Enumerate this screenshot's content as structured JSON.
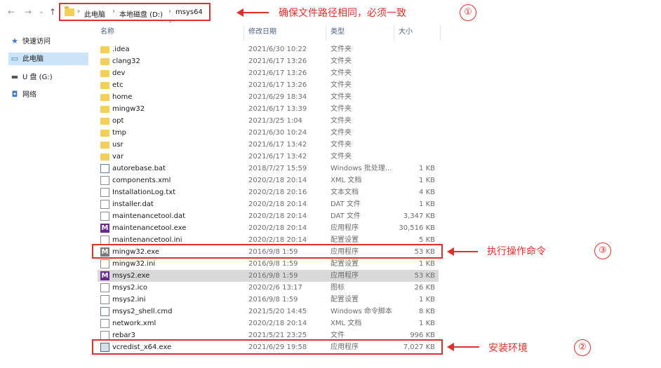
{
  "nav": {
    "back": "←",
    "forward": "→",
    "recent": "⌄",
    "up": "↑"
  },
  "breadcrumb": [
    "此电脑",
    "本地磁盘 (D:)",
    "msys64"
  ],
  "breadcrumb_sep": "›",
  "annotations": [
    {
      "text": "确保文件路径相同，必须一致",
      "number": "①"
    },
    {
      "text": "执行操作命令",
      "number": "③"
    },
    {
      "text": "安装环境",
      "number": "②"
    }
  ],
  "sidebar": [
    {
      "label": "快速访问",
      "icon": "star-icon",
      "selected": false
    },
    {
      "label": "此电脑",
      "icon": "computer-icon",
      "selected": true
    },
    {
      "label": "U 盘 (G:)",
      "icon": "usb-drive-icon",
      "selected": false
    },
    {
      "label": "网络",
      "icon": "network-icon",
      "selected": false
    }
  ],
  "columns": {
    "name": "名称",
    "date": "修改日期",
    "type": "类型",
    "size": "大小"
  },
  "files": [
    {
      "name": ".idea",
      "date": "2021/6/30 10:22",
      "type": "文件夹",
      "size": "",
      "icon": "folder"
    },
    {
      "name": "clang32",
      "date": "2021/6/17 13:26",
      "type": "文件夹",
      "size": "",
      "icon": "folder"
    },
    {
      "name": "dev",
      "date": "2021/6/17 13:26",
      "type": "文件夹",
      "size": "",
      "icon": "folder"
    },
    {
      "name": "etc",
      "date": "2021/6/17 13:26",
      "type": "文件夹",
      "size": "",
      "icon": "folder"
    },
    {
      "name": "home",
      "date": "2021/6/29 18:34",
      "type": "文件夹",
      "size": "",
      "icon": "folder"
    },
    {
      "name": "mingw32",
      "date": "2021/6/17 13:39",
      "type": "文件夹",
      "size": "",
      "icon": "folder"
    },
    {
      "name": "opt",
      "date": "2021/3/25 1:04",
      "type": "文件夹",
      "size": "",
      "icon": "folder"
    },
    {
      "name": "tmp",
      "date": "2021/6/30 10:24",
      "type": "文件夹",
      "size": "",
      "icon": "folder"
    },
    {
      "name": "usr",
      "date": "2021/6/17 13:42",
      "type": "文件夹",
      "size": "",
      "icon": "folder"
    },
    {
      "name": "var",
      "date": "2021/6/17 13:42",
      "type": "文件夹",
      "size": "",
      "icon": "folder"
    },
    {
      "name": "autorebase.bat",
      "date": "2018/7/27 15:59",
      "type": "Windows 批处理...",
      "size": "1 KB",
      "icon": "bat"
    },
    {
      "name": "components.xml",
      "date": "2020/2/18 20:14",
      "type": "XML 文档",
      "size": "1 KB",
      "icon": "file"
    },
    {
      "name": "InstallationLog.txt",
      "date": "2020/2/18 20:16",
      "type": "文本文档",
      "size": "4 KB",
      "icon": "file"
    },
    {
      "name": "installer.dat",
      "date": "2020/2/18 20:14",
      "type": "DAT 文件",
      "size": "1 KB",
      "icon": "file"
    },
    {
      "name": "maintenancetool.dat",
      "date": "2020/2/18 20:14",
      "type": "DAT 文件",
      "size": "3,347 KB",
      "icon": "file"
    },
    {
      "name": "maintenancetool.exe",
      "date": "2020/2/18 20:14",
      "type": "应用程序",
      "size": "30,516 KB",
      "icon": "m"
    },
    {
      "name": "maintenancetool.ini",
      "date": "2020/2/18 20:14",
      "type": "配置设置",
      "size": "5 KB",
      "icon": "file"
    },
    {
      "name": "mingw32.exe",
      "date": "2016/9/8 1:59",
      "type": "应用程序",
      "size": "53 KB",
      "icon": "m-gray"
    },
    {
      "name": "mingw32.ini",
      "date": "2016/9/8 1:59",
      "type": "配置设置",
      "size": "1 KB",
      "icon": "file"
    },
    {
      "name": "msys2.exe",
      "date": "2016/9/8 1:59",
      "type": "应用程序",
      "size": "53 KB",
      "icon": "m"
    },
    {
      "name": "msys2.ico",
      "date": "2020/2/6 13:17",
      "type": "图标",
      "size": "26 KB",
      "icon": "file"
    },
    {
      "name": "msys2.ini",
      "date": "2016/9/8 1:59",
      "type": "配置设置",
      "size": "1 KB",
      "icon": "file"
    },
    {
      "name": "msys2_shell.cmd",
      "date": "2021/5/20 14:45",
      "type": "Windows 命令脚本",
      "size": "8 KB",
      "icon": "bat"
    },
    {
      "name": "network.xml",
      "date": "2020/2/18 20:14",
      "type": "XML 文档",
      "size": "1 KB",
      "icon": "file"
    },
    {
      "name": "rebar3",
      "date": "2021/5/21 23:25",
      "type": "文件",
      "size": "996 KB",
      "icon": "file"
    },
    {
      "name": "vcredist_x64.exe",
      "date": "2021/6/29 19:58",
      "type": "应用程序",
      "size": "7,027 KB",
      "icon": "pkg"
    }
  ],
  "highlighted_row": "msys2.exe",
  "colors": {
    "annotation": "#e0302d",
    "selection": "#cce4f7",
    "row_highlight": "#d9d9d9",
    "folder": "#f3cf5c"
  }
}
